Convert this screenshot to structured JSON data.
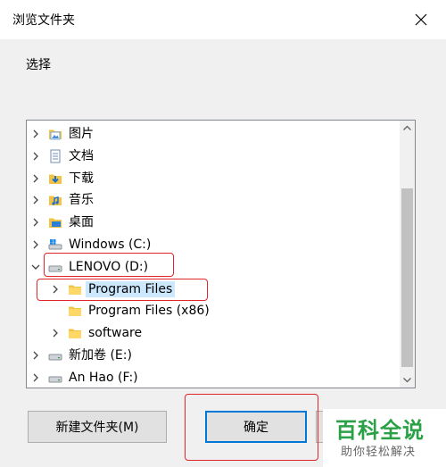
{
  "dialog": {
    "title": "浏览文件夹",
    "subtitle": "选择"
  },
  "tree": {
    "items": [
      {
        "label": "图片",
        "icon": "pictures-folder-icon",
        "expander": "collapsed",
        "depth": 0
      },
      {
        "label": "文档",
        "icon": "documents-folder-icon",
        "expander": "collapsed",
        "depth": 0
      },
      {
        "label": "下载",
        "icon": "downloads-folder-icon",
        "expander": "collapsed",
        "depth": 0
      },
      {
        "label": "音乐",
        "icon": "music-folder-icon",
        "expander": "collapsed",
        "depth": 0
      },
      {
        "label": "桌面",
        "icon": "desktop-folder-icon",
        "expander": "collapsed",
        "depth": 0
      },
      {
        "label": "Windows (C:)",
        "icon": "windows-drive-icon",
        "expander": "collapsed",
        "depth": 0
      },
      {
        "label": "LENOVO (D:)",
        "icon": "drive-icon",
        "expander": "expanded",
        "depth": 0
      },
      {
        "label": "Program Files",
        "icon": "folder-icon",
        "expander": "collapsed",
        "depth": 1,
        "selected": true
      },
      {
        "label": "Program Files (x86)",
        "icon": "folder-icon",
        "expander": "none",
        "depth": 1
      },
      {
        "label": "software",
        "icon": "folder-icon",
        "expander": "collapsed",
        "depth": 1
      },
      {
        "label": "新加卷 (E:)",
        "icon": "drive-icon",
        "expander": "collapsed",
        "depth": 0
      },
      {
        "label": "An Hao (F:)",
        "icon": "drive-icon",
        "expander": "collapsed",
        "depth": 0
      }
    ]
  },
  "buttons": {
    "new_folder": "新建文件夹(M)",
    "ok": "确定"
  },
  "watermark": {
    "brand": "百科全说",
    "slogan": "助你轻松解决"
  },
  "colors": {
    "selection": "#cce8ff",
    "highlight_box": "#e0262b",
    "folder": "#f3c343",
    "accent": "#0078d7",
    "watermark_green": "#2aa146"
  }
}
